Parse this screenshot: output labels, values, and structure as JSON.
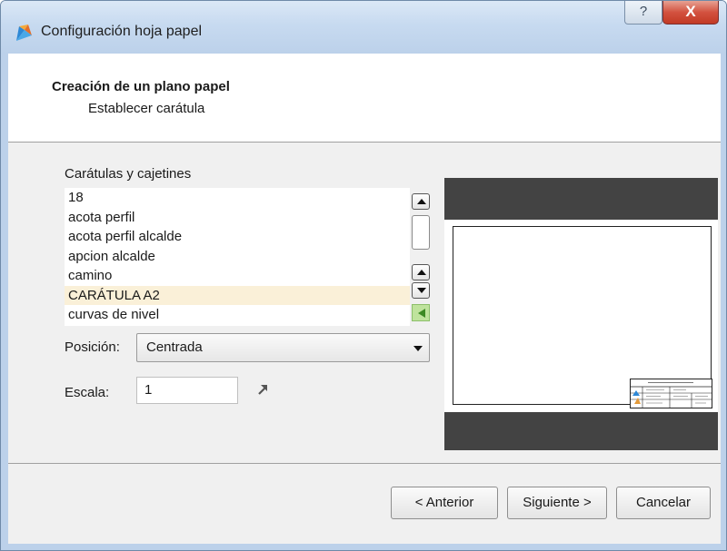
{
  "window": {
    "title": "Configuración hoja papel",
    "help_label": "?",
    "close_label": "X"
  },
  "header": {
    "title": "Creación de un plano papel",
    "subtitle": "Establecer carátula"
  },
  "templates": {
    "label": "Carátulas y cajetines",
    "items": [
      "18",
      "acota perfil",
      "acota perfil alcalde",
      "apcion alcalde",
      "camino",
      "CARÁTULA A2",
      "curvas de nivel"
    ],
    "selected": "CARÁTULA A2"
  },
  "position": {
    "label": "Posición:",
    "value": "Centrada"
  },
  "scale": {
    "label": "Escala:",
    "value": "1"
  },
  "buttons": {
    "back": "< Anterior",
    "next": "Siguiente >",
    "cancel": "Cancelar"
  },
  "icons": {
    "app": "app-icon",
    "expand": "arrow-up-right-icon",
    "scroll_up": "chevron-up-icon",
    "scroll_down": "chevron-down-icon",
    "green": "triangle-left-icon"
  },
  "colors": {
    "titlebar": "#bcd1ea",
    "selected_row": "#faf0d8",
    "preview_bg": "#434343",
    "close_button": "#c9432f"
  }
}
